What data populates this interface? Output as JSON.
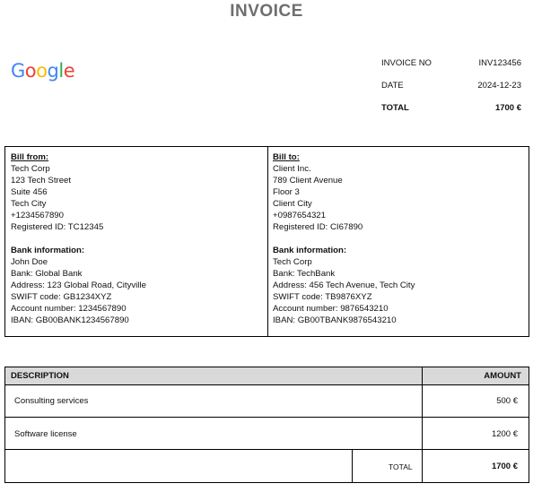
{
  "title": "INVOICE",
  "logo": {
    "letters": [
      "G",
      "o",
      "o",
      "g",
      "l",
      "e"
    ],
    "colors": [
      "#4285F4",
      "#EA4335",
      "#FBBC05",
      "#4285F4",
      "#34A853",
      "#EA4335"
    ]
  },
  "meta": {
    "invoice_no_label": "INVOICE NO",
    "invoice_no": "INV123456",
    "date_label": "DATE",
    "date": "2024-12-23",
    "total_label": "TOTAL",
    "total": "1700 €"
  },
  "bill_from": {
    "heading": "Bill from:",
    "lines": [
      "Tech Corp",
      "123 Tech Street",
      "Suite 456",
      "Tech City",
      "+1234567890",
      "Registered ID: TC12345"
    ],
    "bank_heading": "Bank information:",
    "bank_lines": [
      "John Doe",
      "Bank: Global Bank",
      "Address: 123 Global Road, Cityville",
      "SWIFT code: GB1234XYZ",
      "Account number: 1234567890",
      "IBAN: GB00BANK1234567890"
    ]
  },
  "bill_to": {
    "heading": "Bill to:",
    "lines": [
      "Client Inc.",
      "789 Client Avenue",
      "Floor 3",
      "Client City",
      "+0987654321",
      "Registered ID: CI67890"
    ],
    "bank_heading": "Bank information:",
    "bank_lines": [
      "Tech Corp",
      "Bank: TechBank",
      "Address: 456 Tech Avenue, Tech City",
      "SWIFT code: TB9876XYZ",
      "Account number: 9876543210",
      "IBAN: GB00TBANK9876543210"
    ]
  },
  "items": {
    "description_header": "DESCRIPTION",
    "amount_header": "AMOUNT",
    "rows": [
      {
        "description": "Consulting services",
        "amount": "500 €"
      },
      {
        "description": "Software license",
        "amount": "1200 €"
      }
    ],
    "total_label": "TOTAL",
    "total": "1700 €"
  }
}
